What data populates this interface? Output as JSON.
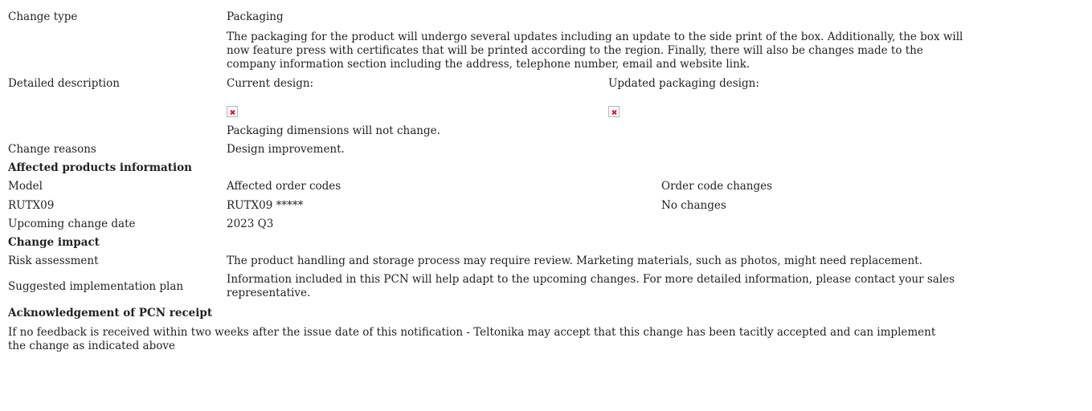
{
  "change": {
    "type_label": "Change type",
    "type_value": "Packaging",
    "summary_line1": "The packaging for the product will undergo several updates including an update to the side print of the box. Additionally, the box will",
    "summary_line2": "now feature press with certificates that will be printed according to the region. Finally, there will also be changes made to the",
    "summary_line3": "company information section including the address, telephone number, email and website link.",
    "detailed_label": "Detailed description",
    "current_design": "Current design:",
    "updated_design": "Updated packaging design:",
    "current_image_icon": "broken-image-icon",
    "updated_image_icon": "broken-image-icon",
    "dimensions_note": "Packaging dimensions will not change.",
    "reasons_label": "Change reasons",
    "reasons_value": "Design improvement."
  },
  "affected": {
    "heading": "Affected products information",
    "headers": [
      "Model",
      "Affected order codes",
      "Order code changes"
    ],
    "rows": [
      [
        "RUTX09",
        "RUTX09 *****",
        "No changes"
      ]
    ],
    "date_label": "Upcoming change date",
    "date_value": "2023 Q3"
  },
  "impact": {
    "heading": "Change impact",
    "risk_label": "Risk assessment",
    "risk_value": "The product handling and storage process may require review. Marketing materials, such as photos, might need replacement.",
    "plan_label": "Suggested implementation plan",
    "plan_line1": "Information included in this PCN will help adapt to the upcoming changes. For more detailed information, please contact your sales",
    "plan_line2": "representative."
  },
  "ack": {
    "heading": "Acknowledgement of PCN receipt",
    "line1": "If no feedback is received within two weeks after the issue date of this notification - Teltonika may accept that this change has been tacitly accepted and can implement",
    "line2": "the change as indicated above"
  }
}
